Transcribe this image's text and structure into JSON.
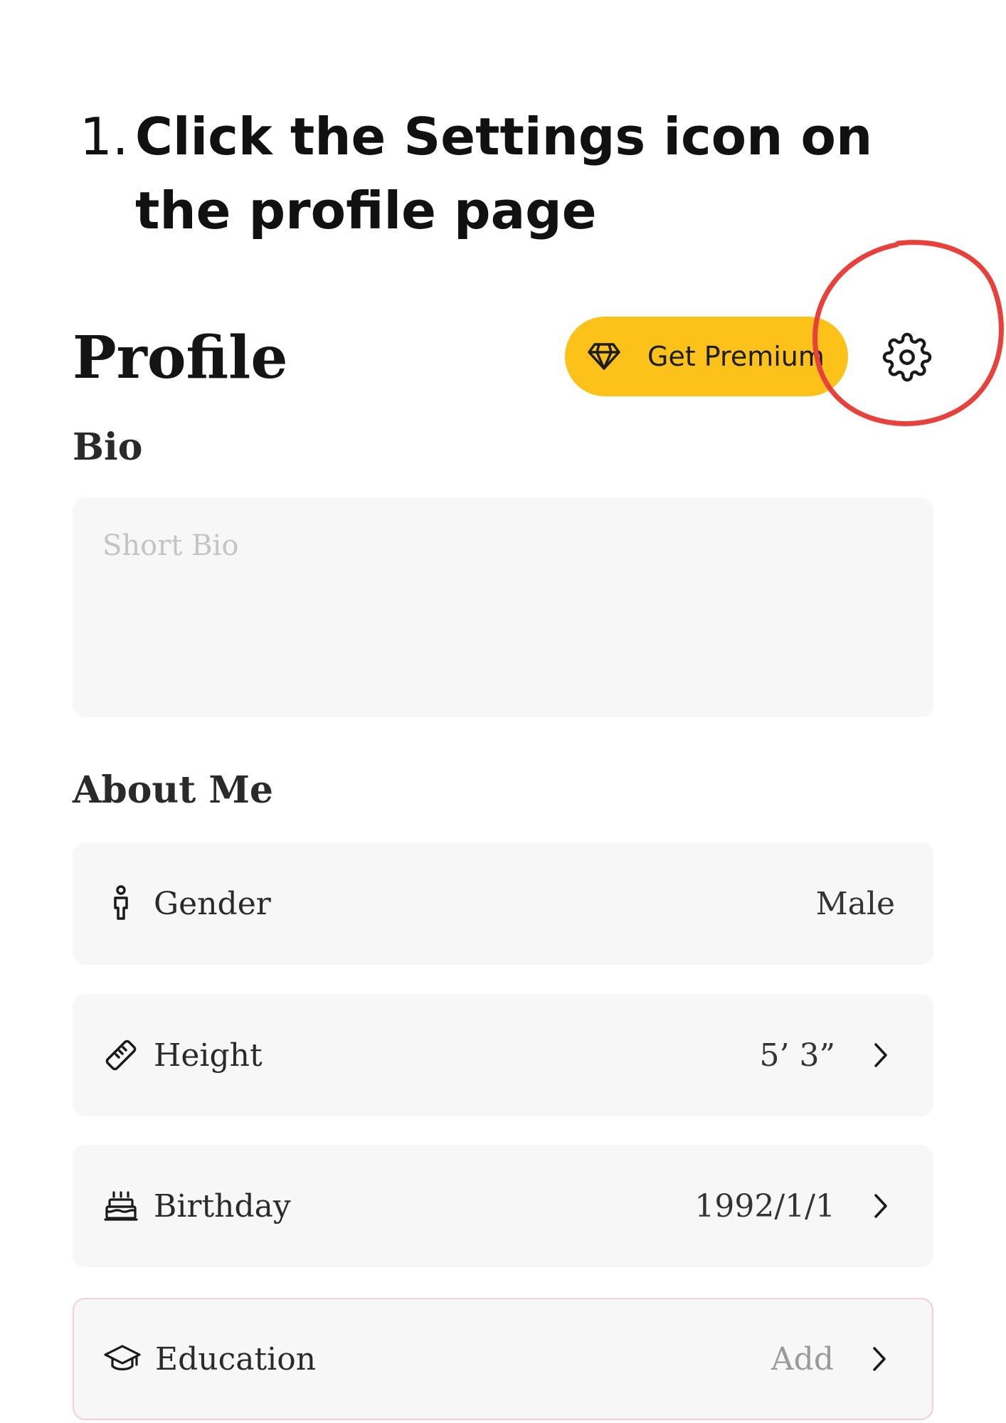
{
  "instruction": {
    "number": "1.",
    "text": "Click the Settings icon on the profile page"
  },
  "header": {
    "title": "Profile",
    "premium_label": "Get Premium",
    "premium_icon": "diamond-icon",
    "settings_icon": "gear-icon"
  },
  "bio": {
    "label": "Bio",
    "placeholder": "Short Bio",
    "value": ""
  },
  "about": {
    "label": "About Me",
    "items": [
      {
        "label": "Gender",
        "value": "Male",
        "icon": "person-icon",
        "chevron": false
      },
      {
        "label": "Height",
        "value": "5’ 3”",
        "icon": "ruler-icon",
        "chevron": true
      },
      {
        "label": "Birthday",
        "value": "1992/1/1",
        "icon": "cake-icon",
        "chevron": true
      },
      {
        "label": "Education",
        "value": "Add",
        "icon": "graduation-cap-icon",
        "chevron": true,
        "is_placeholder": true
      }
    ]
  },
  "colors": {
    "premium": "#fdc219",
    "highlight": "#e8403a",
    "row_background": "#f7f7f7",
    "education_border": "#f2cfd6"
  }
}
